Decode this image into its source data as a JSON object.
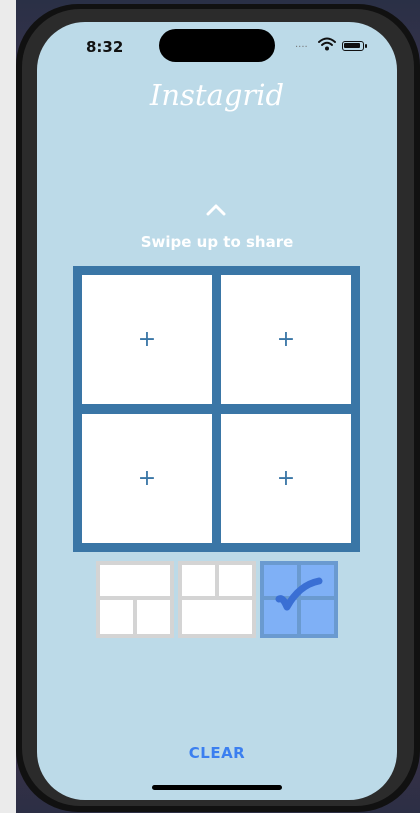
{
  "status_bar": {
    "time": "8:32",
    "signal": "....",
    "wifi_icon": "wifi-icon",
    "battery_icon": "battery-icon"
  },
  "app": {
    "title": "Instagrid",
    "swipe_label": "Swipe up to share",
    "swipe_icon": "chevron-up-icon"
  },
  "grid": {
    "cells": [
      "+",
      "+",
      "+",
      "+"
    ]
  },
  "layouts": {
    "options": [
      "layout-top-one-bottom-two",
      "layout-top-two-bottom-one",
      "layout-four-squares"
    ],
    "selected_index": 2
  },
  "actions": {
    "clear_label": "CLEAR"
  },
  "colors": {
    "background": "#bcdae8",
    "grid": "#3a76a6",
    "accent": "#3b7ff0",
    "selected": "#7fb0f6"
  }
}
